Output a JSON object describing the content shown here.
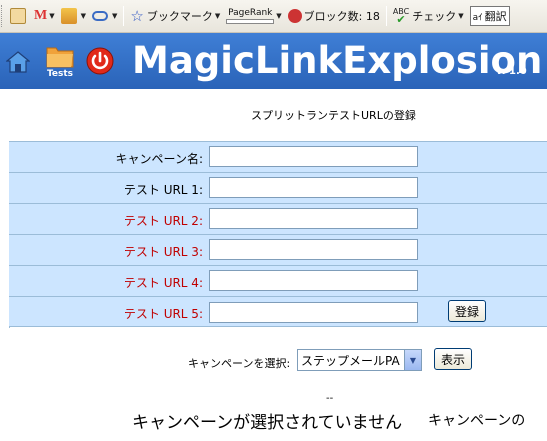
{
  "toolbar": {
    "gmail_label": "M",
    "bookmark_label": "ブックマーク",
    "pagerank_label": "PageRank",
    "block_label": "ブロック数: 18",
    "abc_label": "ABC",
    "check_label": "チェック",
    "translate_prefix": "aｲ",
    "translate_label": "翻訳"
  },
  "header": {
    "tests_label": "Tests",
    "title": "MagicLinkExplosion",
    "version": "v. 1.0"
  },
  "subtitle": "スプリットランテストURLの登録",
  "form": {
    "campaign_label": "キャンペーン名:",
    "url1_label": "テスト URL 1:",
    "url2_label": "テスト URL 2:",
    "url3_label": "テスト URL 3:",
    "url4_label": "テスト URL 4:",
    "url5_label": "テスト URL 5:",
    "campaign_value": "",
    "url1_value": "",
    "url2_value": "",
    "url3_value": "",
    "url4_value": "",
    "url5_value": "",
    "register_button": "登録"
  },
  "campaign_select": {
    "label": "キャンペーンを選択:",
    "selected": "ステップメールPA",
    "show_button": "表示"
  },
  "status": {
    "dashes": "--",
    "message": "キャンペーンが選択されていません",
    "trailing": "キャンペーンの"
  },
  "colors": {
    "header_blue": "#2a63b8",
    "form_bg": "#cce5ff",
    "required_red": "#c00000"
  }
}
